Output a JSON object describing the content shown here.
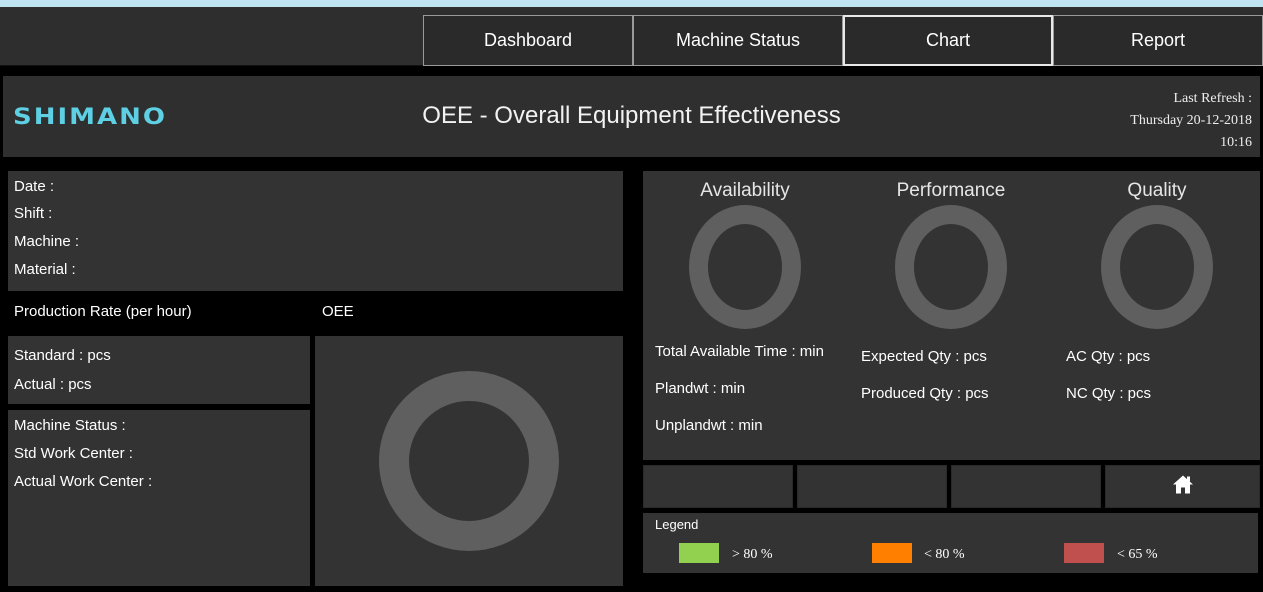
{
  "nav": {
    "items": [
      {
        "label": "Dashboard"
      },
      {
        "label": "Machine Status"
      },
      {
        "label": "Chart"
      },
      {
        "label": "Report"
      }
    ],
    "active": "Chart"
  },
  "header": {
    "logo": "SHIMANO",
    "title": "OEE - Overall Equipment Effectiveness",
    "refresh_label": "Last Refresh :",
    "refresh_date": "Thursday 20-12-2018",
    "refresh_time": "10:16"
  },
  "info": {
    "date": "Date :",
    "shift": "Shift :",
    "machine": "Machine :",
    "material": "Material :"
  },
  "production": {
    "rate_label": "Production Rate (per hour)",
    "oee_label": "OEE",
    "standard": "Standard : pcs",
    "actual": "Actual : pcs"
  },
  "machine": {
    "status": "Machine Status :",
    "std_work_center": "Std Work Center :",
    "actual_work_center": "Actual Work Center :"
  },
  "metrics": {
    "availability": {
      "title": "Availability",
      "lines": [
        "Total Available Time : min",
        "Plandwt : min",
        "Unplandwt : min"
      ]
    },
    "performance": {
      "title": "Performance",
      "lines": [
        "Expected Qty : pcs",
        "Produced Qty : pcs"
      ]
    },
    "quality": {
      "title": "Quality",
      "lines": [
        "AC Qty : pcs",
        "NC Qty : pcs"
      ]
    }
  },
  "legend": {
    "title": "Legend",
    "items": [
      {
        "label": "> 80 %",
        "color": "#92d050"
      },
      {
        "label": "< 80 %",
        "color": "#ff7f00"
      },
      {
        "label": "< 65 %",
        "color": "#c0504d"
      }
    ]
  },
  "icons": {
    "home": "home-icon"
  },
  "colors": {
    "logo": "#5ed0e3",
    "panel": "#333333",
    "ring": "#5f5f5f",
    "background": "#000000"
  }
}
